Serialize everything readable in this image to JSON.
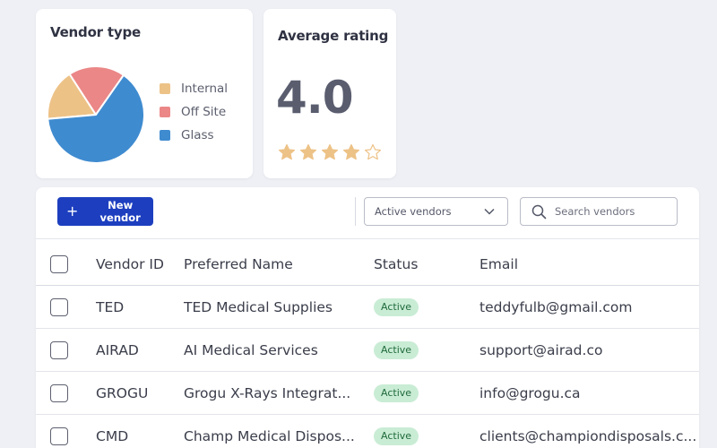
{
  "vendor_type": {
    "title": "Vendor type",
    "legend": [
      {
        "label": "Internal",
        "color": "#edc287"
      },
      {
        "label": "Off Site",
        "color": "#eb8787"
      },
      {
        "label": "Glass",
        "color": "#3f8bd0"
      }
    ]
  },
  "rating": {
    "title": "Average rating",
    "value": "4.0",
    "filled_stars": 4,
    "total_stars": 5,
    "star_color": "#edc287"
  },
  "toolbar": {
    "new_vendor_label": "New vendor",
    "filter_value": "Active vendors",
    "search_placeholder": "Search vendors"
  },
  "table": {
    "headers": {
      "id": "Vendor ID",
      "name": "Preferred Name",
      "status": "Status",
      "email": "Email"
    },
    "rows": [
      {
        "id": "TED",
        "name": "TED Medical Supplies",
        "status": "Active",
        "email": "teddyfulb@gmail.com"
      },
      {
        "id": "AIRAD",
        "name": "AI Medical Services",
        "status": "Active",
        "email": "support@airad.co"
      },
      {
        "id": "GROGU",
        "name": "Grogu X-Rays Integrat...",
        "status": "Active",
        "email": "info@grogu.ca"
      },
      {
        "id": "CMD",
        "name": "Champ Medical Dispos...",
        "status": "Active",
        "email": "clients@championdisposals.c..."
      }
    ]
  },
  "colors": {
    "primary": "#1d3fbf",
    "active_badge_bg": "#c9ecd5",
    "active_badge_text": "#1f6a3a"
  }
}
